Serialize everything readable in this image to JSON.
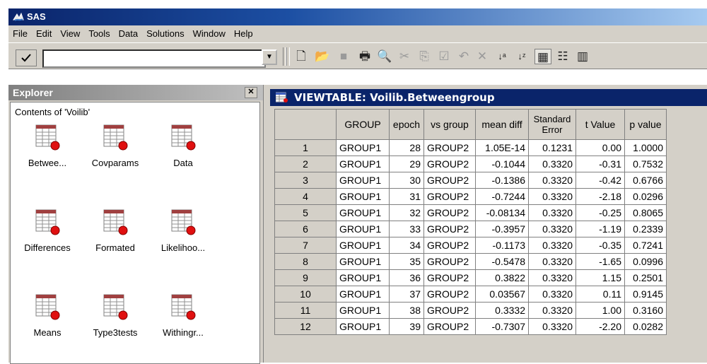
{
  "app": {
    "title": "SAS"
  },
  "menu": [
    "File",
    "Edit",
    "View",
    "Tools",
    "Data",
    "Solutions",
    "Window",
    "Help"
  ],
  "toolbar": {
    "command_value": "",
    "icons": [
      "new-icon",
      "open-icon",
      "save-icon",
      "print-icon",
      "print-preview-icon",
      "cut-icon",
      "copy-icon",
      "paste-icon",
      "undo-icon",
      "delete-icon",
      "sort-ascending-icon",
      "sort-descending-icon",
      "table-view-icon",
      "form-view-icon",
      "columns-icon"
    ]
  },
  "explorer": {
    "title": "Explorer",
    "path": "Contents of 'Voilib'",
    "items": [
      "Betwee...",
      "Covparams",
      "Data",
      "Differences",
      "Formated",
      "Likelihoo...",
      "Means",
      "Type3tests",
      "Withingr..."
    ]
  },
  "viewtable": {
    "title": "VIEWTABLE: Voilib.Betweengroup",
    "columns": [
      "GROUP",
      "epoch",
      "vs group",
      "mean diff",
      "Standard Error",
      "t Value",
      "p value"
    ],
    "rows": [
      [
        "1",
        "GROUP1",
        "28",
        "GROUP2",
        "1.05E-14",
        "0.1231",
        "0.00",
        "1.0000"
      ],
      [
        "2",
        "GROUP1",
        "29",
        "GROUP2",
        "-0.1044",
        "0.3320",
        "-0.31",
        "0.7532"
      ],
      [
        "3",
        "GROUP1",
        "30",
        "GROUP2",
        "-0.1386",
        "0.3320",
        "-0.42",
        "0.6766"
      ],
      [
        "4",
        "GROUP1",
        "31",
        "GROUP2",
        "-0.7244",
        "0.3320",
        "-2.18",
        "0.0296"
      ],
      [
        "5",
        "GROUP1",
        "32",
        "GROUP2",
        "-0.08134",
        "0.3320",
        "-0.25",
        "0.8065"
      ],
      [
        "6",
        "GROUP1",
        "33",
        "GROUP2",
        "-0.3957",
        "0.3320",
        "-1.19",
        "0.2339"
      ],
      [
        "7",
        "GROUP1",
        "34",
        "GROUP2",
        "-0.1173",
        "0.3320",
        "-0.35",
        "0.7241"
      ],
      [
        "8",
        "GROUP1",
        "35",
        "GROUP2",
        "-0.5478",
        "0.3320",
        "-1.65",
        "0.0996"
      ],
      [
        "9",
        "GROUP1",
        "36",
        "GROUP2",
        "0.3822",
        "0.3320",
        "1.15",
        "0.2501"
      ],
      [
        "10",
        "GROUP1",
        "37",
        "GROUP2",
        "0.03567",
        "0.3320",
        "0.11",
        "0.9145"
      ],
      [
        "11",
        "GROUP1",
        "38",
        "GROUP2",
        "0.3332",
        "0.3320",
        "1.00",
        "0.3160"
      ],
      [
        "12",
        "GROUP1",
        "39",
        "GROUP2",
        "-0.7307",
        "0.3320",
        "-2.20",
        "0.0282"
      ]
    ]
  },
  "colors": {
    "title_bar": "#0a246a",
    "chrome": "#d4d0c8",
    "icon_badge": "#e01010"
  }
}
